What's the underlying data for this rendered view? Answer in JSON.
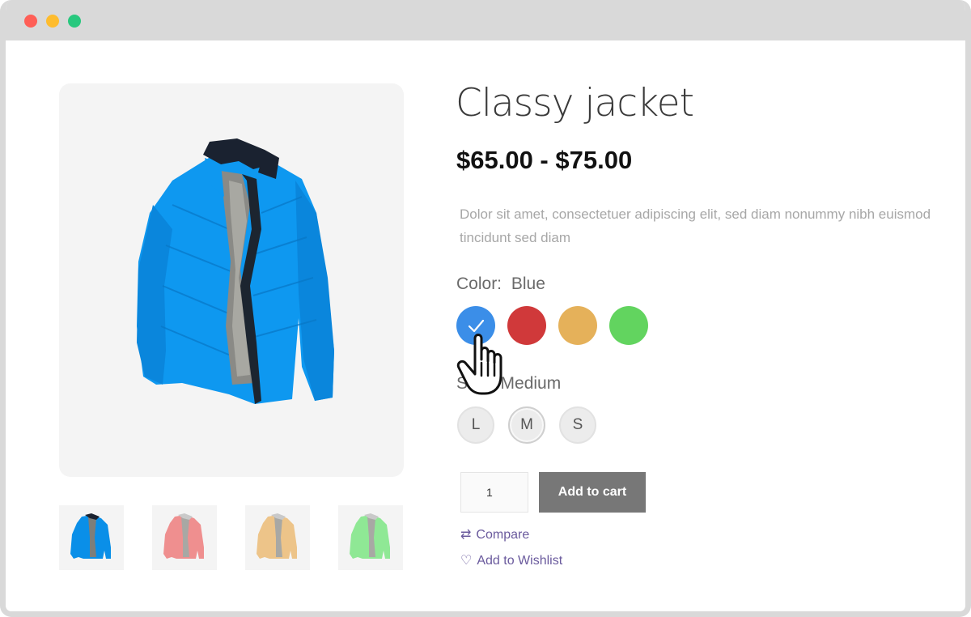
{
  "window": {
    "controls": [
      {
        "name": "close",
        "color": "#ff5f57"
      },
      {
        "name": "minimize",
        "color": "#febc2e"
      },
      {
        "name": "maximize",
        "color": "#28c87e"
      }
    ]
  },
  "product": {
    "title": "Classy jacket",
    "price": "$65.00 - $75.00",
    "description": "Dolor sit amet, consectetuer adipiscing elit, sed diam nonummy nibh euismod tincidunt sed diam",
    "main_image_icon": "blue-jacket-icon",
    "thumbnails": [
      {
        "icon": "blue-jacket-icon",
        "color": "#0a8fe8"
      },
      {
        "icon": "red-jacket-icon",
        "color": "#ef8f8f"
      },
      {
        "icon": "orange-jacket-icon",
        "color": "#edc489"
      },
      {
        "icon": "green-jacket-icon",
        "color": "#8fe895"
      }
    ]
  },
  "color_attribute": {
    "label": "Color:",
    "selected": "Blue",
    "swatches": [
      {
        "name": "Blue",
        "color": "#3b8ee8",
        "selected": true
      },
      {
        "name": "Red",
        "color": "#d0393a",
        "selected": false
      },
      {
        "name": "Orange",
        "color": "#e5b15a",
        "selected": false
      },
      {
        "name": "Green",
        "color": "#62d45f",
        "selected": false
      }
    ]
  },
  "size_attribute": {
    "label": "Size:",
    "selected": "Medium",
    "options": [
      {
        "label": "L",
        "selected": false
      },
      {
        "label": "M",
        "selected": true
      },
      {
        "label": "S",
        "selected": false
      }
    ]
  },
  "cart": {
    "quantity": "1",
    "add_label": "Add to cart"
  },
  "links": {
    "compare": "Compare",
    "wishlist": "Add to Wishlist",
    "compare_icon": "compare-arrows-icon",
    "wishlist_icon": "heart-icon"
  }
}
